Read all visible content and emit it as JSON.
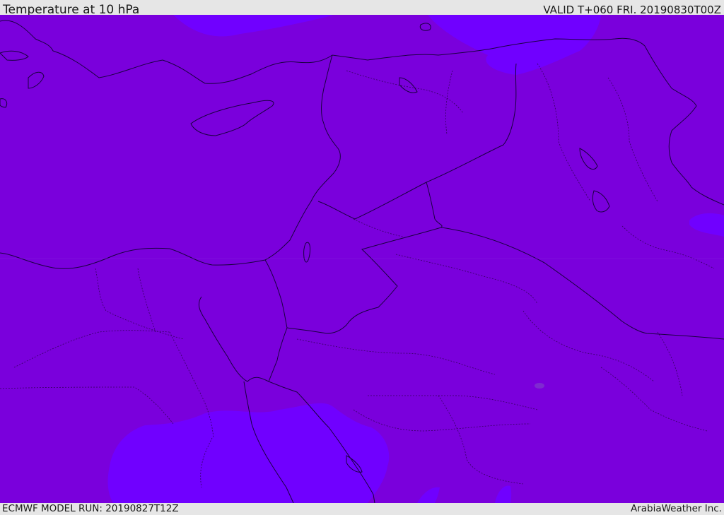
{
  "header": {
    "title": "Temperature at 10 hPa",
    "valid": "VALID T+060 FRI. 20190830T00Z"
  },
  "footer": {
    "model_run": "ECMWF MODEL RUN: 20190827T12Z",
    "credit": "ArabiaWeather Inc."
  },
  "colors": {
    "base_field": "#7a00dc",
    "warmer_field": "#7000ff",
    "coast_line": "#1a0040",
    "frame": "#e6e6e6"
  }
}
